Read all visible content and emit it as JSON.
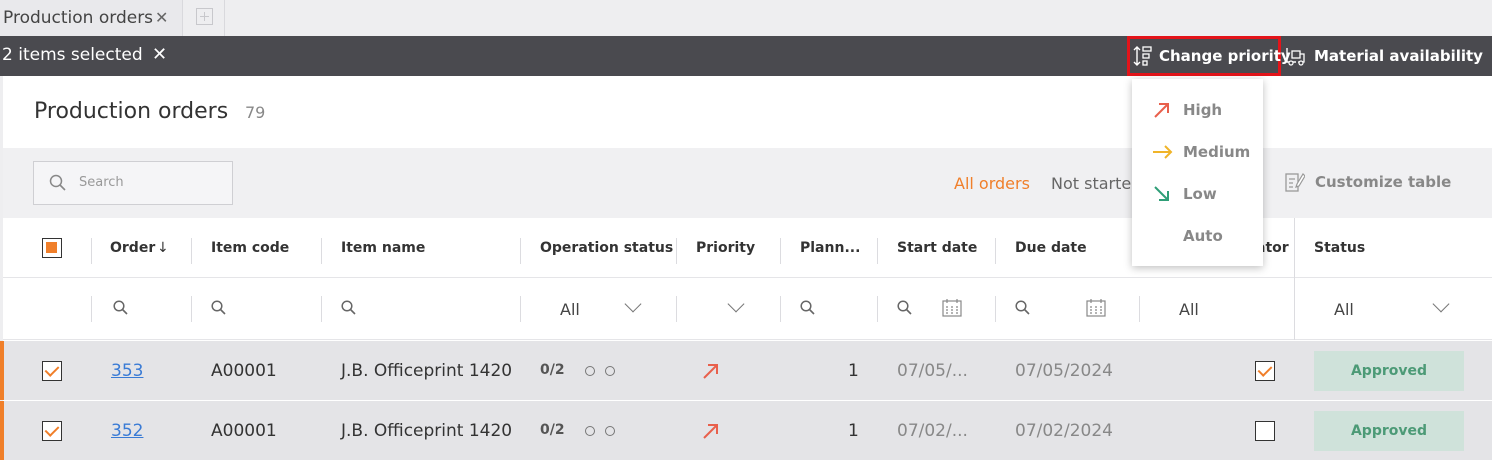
{
  "tab": {
    "label": "Production orders"
  },
  "selection": {
    "count_label": "2 items selected"
  },
  "actions": {
    "change_priority": "Change priority",
    "material_availability": "Material availability"
  },
  "page": {
    "title": "Production orders",
    "count": "79"
  },
  "search": {
    "placeholder": "Search"
  },
  "filters": {
    "all_orders": "All orders",
    "not_started": "Not starte"
  },
  "customize": {
    "label": "Customize table"
  },
  "columns": {
    "order": "Order",
    "item_code": "Item code",
    "item_name": "Item name",
    "operation_status": "Operation status",
    "priority": "Priority",
    "planned": "Plann...",
    "start_date": "Start date",
    "due_date": "Due date",
    "indicator": "ator",
    "status": "Status"
  },
  "column_filters": {
    "operation_status": "All",
    "indicator": "All",
    "status": "All"
  },
  "rows": [
    {
      "order": "353",
      "item_code": "A00001",
      "item_name": "J.B. Officeprint 1420",
      "op_status": "0/2",
      "planned": "1",
      "start_date": "07/05/...",
      "due_date": "07/05/2024",
      "status": "Approved",
      "indicator_checked": true
    },
    {
      "order": "352",
      "item_code": "A00001",
      "item_name": "J.B. Officeprint 1420",
      "op_status": "0/2",
      "planned": "1",
      "start_date": "07/02/...",
      "due_date": "07/02/2024",
      "status": "Approved",
      "indicator_checked": false
    }
  ],
  "priority_menu": [
    {
      "label": "High",
      "icon": "arrow-up-right-icon",
      "color": "#e8604c"
    },
    {
      "label": "Medium",
      "icon": "arrow-right-icon",
      "color": "#f0b429"
    },
    {
      "label": "Low",
      "icon": "arrow-down-right-icon",
      "color": "#2f9e77"
    },
    {
      "label": "Auto",
      "icon": "",
      "color": ""
    }
  ],
  "colors": {
    "accent": "#f07f2a",
    "link": "#3a7bd5",
    "highlight": "#e3141a",
    "approved_bg": "#cfe2da",
    "approved_fg": "#4c9a76"
  }
}
